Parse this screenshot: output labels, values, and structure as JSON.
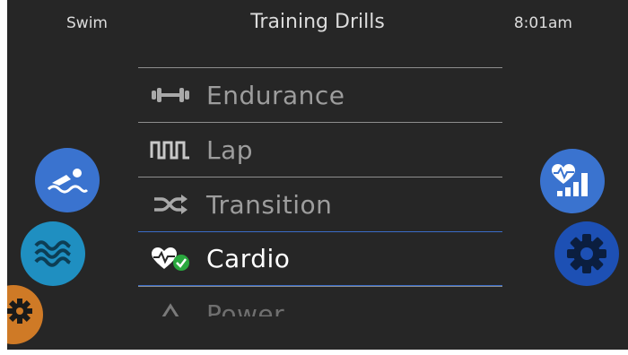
{
  "header": {
    "mode_label": "Swim",
    "title": "Training Drills",
    "clock": "8:01am"
  },
  "menu": {
    "items": [
      {
        "label": "Endurance",
        "icon": "dumbbell-icon",
        "state": "normal"
      },
      {
        "label": "Lap",
        "icon": "square-wave-icon",
        "state": "normal"
      },
      {
        "label": "Transition",
        "icon": "shuffle-icon",
        "state": "normal"
      },
      {
        "label": "Cardio",
        "icon": "heart-check-icon",
        "state": "selected"
      },
      {
        "label": "Power",
        "icon": "triangle-icon",
        "state": "partially-visible"
      }
    ]
  },
  "side_buttons": {
    "left": [
      "swimmer-icon",
      "waves-icon",
      "gear-icon"
    ],
    "right": [
      "heart-stats-icon",
      "gear-icon"
    ]
  },
  "colors": {
    "background": "#262626",
    "accent_blue": "#3a73cf",
    "cyan": "#1f8fc1",
    "dark_blue": "#1d50b4",
    "orange": "#cf7a26",
    "check_green": "#29a83e"
  }
}
